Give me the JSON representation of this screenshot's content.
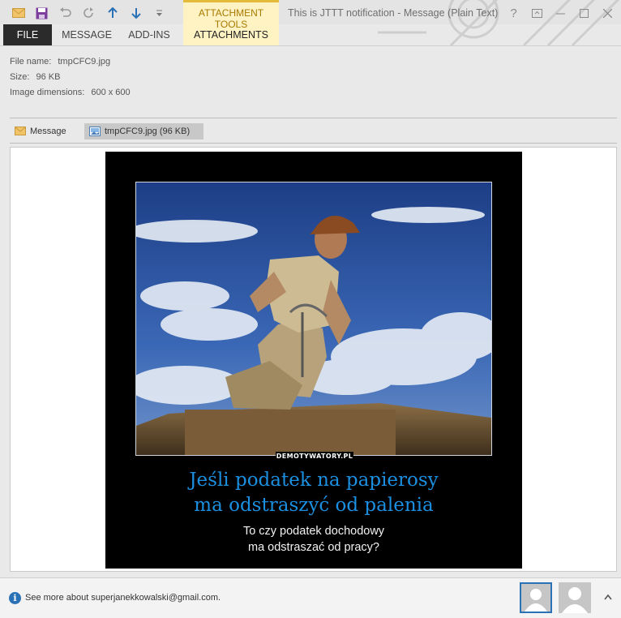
{
  "window": {
    "title": "This is JTTT notification - Message (Plain Text)",
    "context_group": "ATTACHMENT TOOLS"
  },
  "ribbon": {
    "tabs": [
      {
        "label": "FILE"
      },
      {
        "label": "MESSAGE"
      },
      {
        "label": "ADD-INS"
      },
      {
        "label": "ATTACHMENTS"
      }
    ]
  },
  "attachment_info": {
    "file_name_label": "File name:",
    "file_name": "tmpCFC9.jpg",
    "size_label": "Size:",
    "size": "96 KB",
    "dimensions_label": "Image dimensions:",
    "dimensions": "600 x 600"
  },
  "attachment_strip": {
    "message_label": "Message",
    "attachment_label": "tmpCFC9.jpg (96 KB)"
  },
  "poster": {
    "brand": "DEMOTYWATORY.PL",
    "headline_1": "Jeśli podatek na papierosy",
    "headline_2": "ma odstraszyć od palenia",
    "sub_1": "To czy podatek dochodowy",
    "sub_2": "ma odstraszać od pracy?"
  },
  "people_pane": {
    "text": "See more about superjanekkowalski@gmail.com."
  },
  "colors": {
    "file_tab": "#2b2b2b",
    "context_tab": "#fff3c4",
    "context_accent": "#e3ba3a",
    "headline": "#1b8fe0"
  }
}
